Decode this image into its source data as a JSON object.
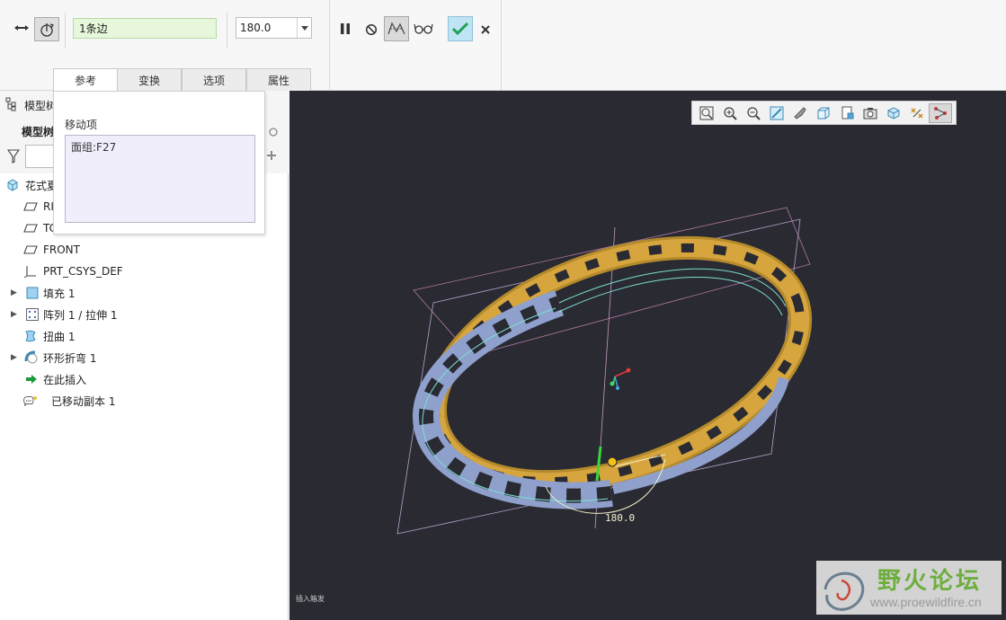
{
  "dashboard": {
    "edge_field": "1条边",
    "angle_value": "180.0",
    "tabs": [
      {
        "label": "参考",
        "active": true
      },
      {
        "label": "变换",
        "active": false
      },
      {
        "label": "选项",
        "active": false
      },
      {
        "label": "属性",
        "active": false
      }
    ],
    "accent_color": "#2bb673"
  },
  "reference_panel": {
    "title": "移动项",
    "items": [
      "面组:F27"
    ]
  },
  "model_tree": {
    "header_title": "模型树",
    "subheader": "模型树",
    "root": "花式夏",
    "items": [
      {
        "label": "RI",
        "icon": "datum-plane-icon"
      },
      {
        "label": "TC",
        "icon": "datum-plane-icon"
      },
      {
        "label": "FRONT",
        "icon": "datum-plane-icon"
      },
      {
        "label": "PRT_CSYS_DEF",
        "icon": "csys-icon"
      },
      {
        "label": "填充 1",
        "icon": "fill-icon"
      },
      {
        "label": "阵列 1 / 拉伸 1",
        "icon": "pattern-icon"
      },
      {
        "label": "扭曲 1",
        "icon": "warp-icon"
      },
      {
        "label": "环形折弯 1",
        "icon": "toroidal-bend-icon"
      },
      {
        "label": "在此插入",
        "icon": "insert-here-icon"
      },
      {
        "label": "已移动副本 1",
        "icon": "moved-copy-icon"
      }
    ]
  },
  "graphics": {
    "dimension_label": "180.0",
    "status_text": "插入箱发",
    "background_color": "#2a2a33",
    "watermark_text": "野火论坛",
    "watermark_url": "www.proewildfire.cn"
  }
}
